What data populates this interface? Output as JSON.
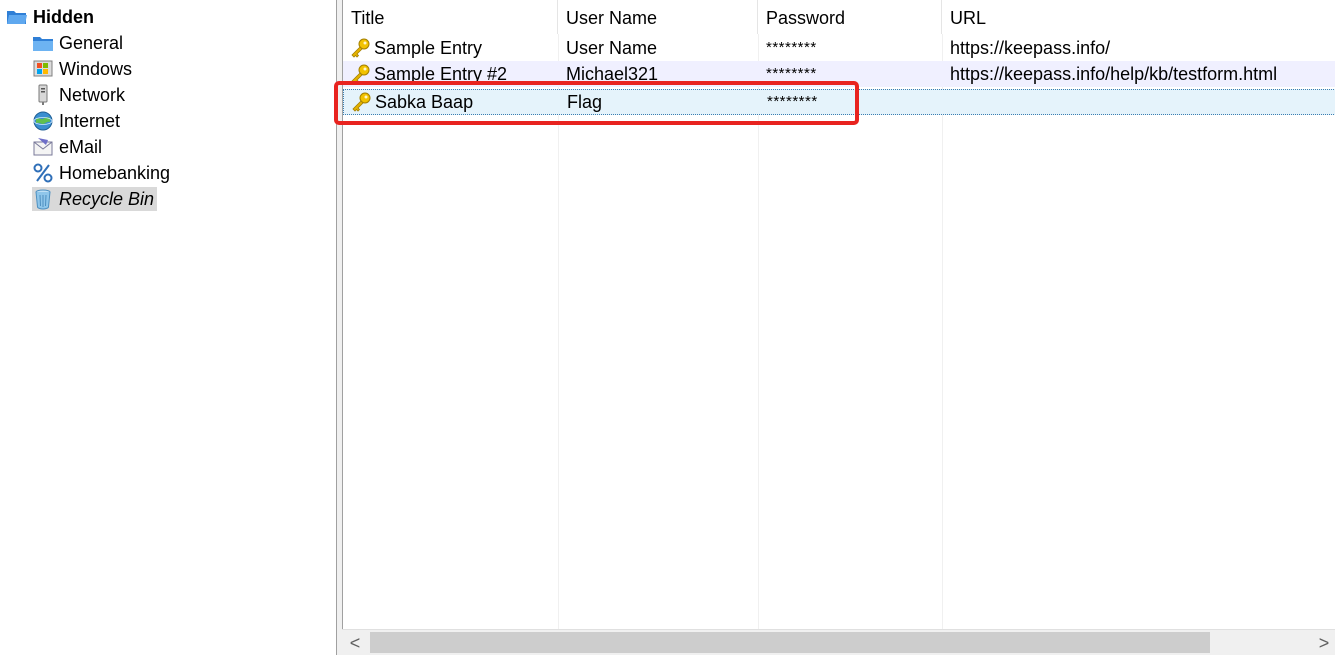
{
  "tree": {
    "root": {
      "label": "Hidden",
      "icon": "folder-open-icon"
    },
    "groups": [
      {
        "label": "General",
        "icon": "folder-icon"
      },
      {
        "label": "Windows",
        "icon": "windows-logo-icon"
      },
      {
        "label": "Network",
        "icon": "network-server-icon"
      },
      {
        "label": "Internet",
        "icon": "globe-icon"
      },
      {
        "label": "eMail",
        "icon": "envelope-icon"
      },
      {
        "label": "Homebanking",
        "icon": "percent-icon"
      },
      {
        "label": "Recycle Bin",
        "icon": "recycle-bin-icon",
        "selected": true
      }
    ]
  },
  "entries": {
    "columns": [
      "Title",
      "User Name",
      "Password",
      "URL"
    ],
    "rows": [
      {
        "title": "Sample Entry",
        "username": "User Name",
        "password": "********",
        "url": "https://keepass.info/"
      },
      {
        "title": "Sample Entry #2",
        "username": "Michael321",
        "password": "********",
        "url": "https://keepass.info/help/kb/testform.html"
      },
      {
        "title": "Sabka Baap",
        "username": "Flag",
        "password": "********",
        "url": "",
        "selected": true
      }
    ]
  },
  "scrollbar": {
    "left_arrow": "<",
    "right_arrow": ">"
  },
  "colors": {
    "highlight_box": "#e8231f",
    "selection_row": "#e5f3fb",
    "alternate_row": "#f0f0ff"
  }
}
